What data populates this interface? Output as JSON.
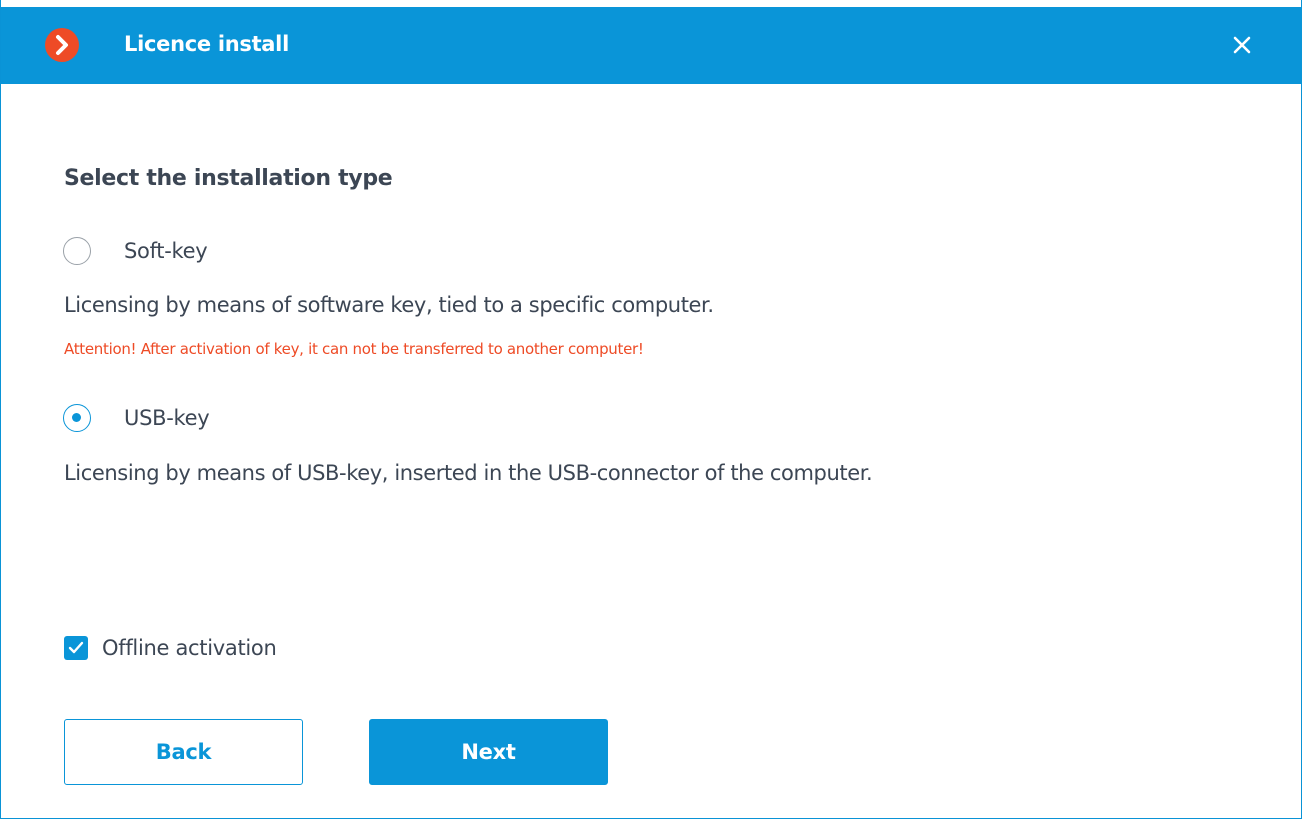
{
  "window": {
    "title": "Licence install",
    "close_icon": "close-icon",
    "logo_icon": "chevron-right-icon",
    "accent_color": "#0a95d8",
    "logo_color": "#ee4b26"
  },
  "form": {
    "section_title": "Select the installation type",
    "options": [
      {
        "label": "Soft-key",
        "checked": false,
        "description": "Licensing by means of software key, tied to a specific computer.",
        "warning": "Attention! After activation of key, it can not be transferred to another computer!"
      },
      {
        "label": "USB-key",
        "checked": true,
        "description": "Licensing by means of USB-key, inserted in the USB-connector of the computer."
      }
    ],
    "offline_activation": {
      "label": "Offline activation",
      "checked": true
    }
  },
  "buttons": {
    "back_label": "Back",
    "next_label": "Next"
  },
  "colors": {
    "warning": "#ee4b26",
    "text": "#3c4654"
  }
}
